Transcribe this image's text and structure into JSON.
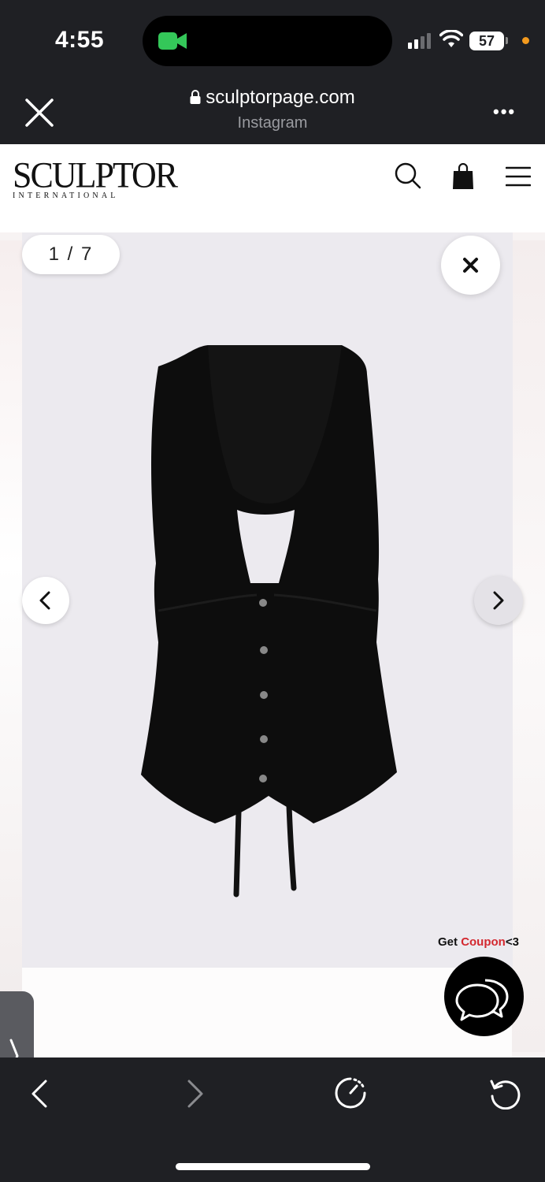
{
  "status_bar": {
    "time": "4:55",
    "battery": "57",
    "colors": {
      "camera_indicator": "#34c759",
      "recording_dot": "#f39a1e"
    }
  },
  "browser": {
    "url": "sculptorpage.com",
    "source": "Instagram",
    "close_icon": "close-icon",
    "more_icon": "more-icon",
    "more_label": "•••"
  },
  "site": {
    "logo_main": "SCULPTOR",
    "logo_sub": "INTERNATIONAL",
    "icons": [
      "search-icon",
      "shopping-bag-icon",
      "menu-icon"
    ]
  },
  "gallery": {
    "current": "1",
    "separator": "/",
    "total": "7",
    "counter_text": "1 / 7",
    "image_subject": "black sleeveless corset vest with cut-out front and tie straps"
  },
  "coupon": {
    "prefix": "Get ",
    "highlight": "Coupon",
    "suffix": "<3",
    "highlight_color": "#d3282f"
  },
  "toolbar": {
    "icons": [
      "back-icon",
      "forward-icon",
      "speed-icon",
      "reload-icon"
    ]
  }
}
